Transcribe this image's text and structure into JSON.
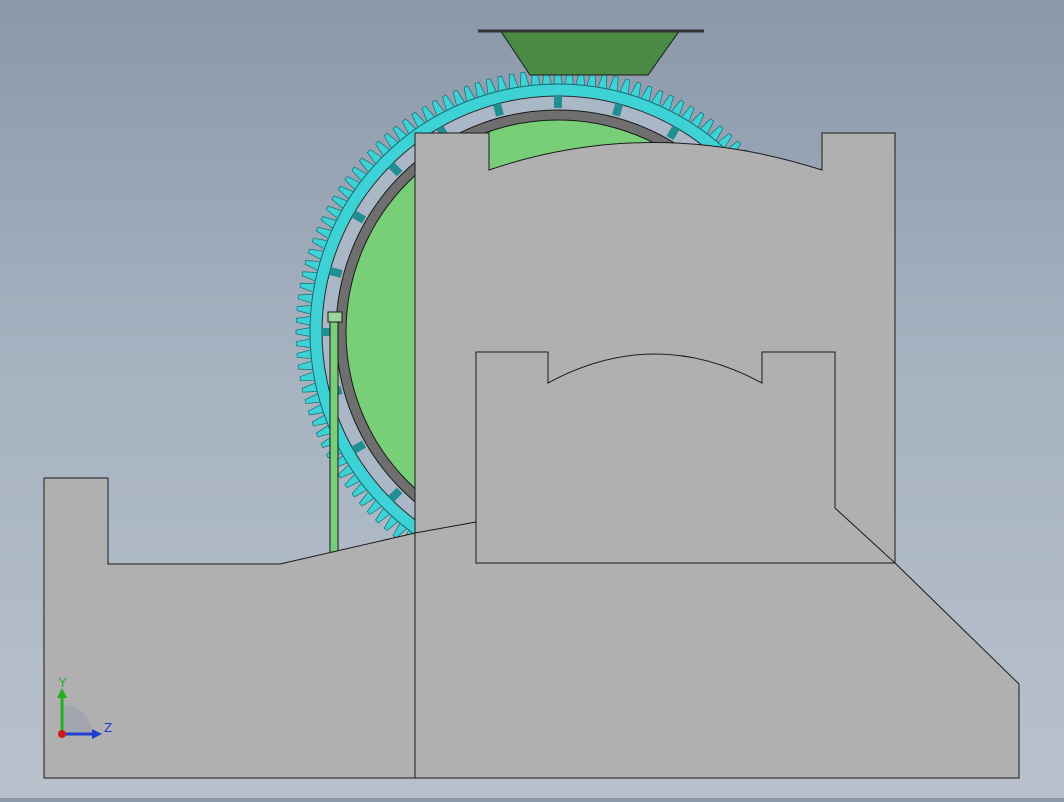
{
  "viewport": {
    "background_top": "#8a98aa",
    "background_bottom": "#b9c1cd"
  },
  "model": {
    "body_color": "#b0b0b0",
    "gear_color": "#3cd2d6",
    "drum_color": "#78cf78",
    "bracket_color": "#4a8a44",
    "ring_color": "#6f6f6f"
  },
  "triad": {
    "y_label": "Y",
    "z_label": "Z",
    "y_color": "#22b022",
    "z_color": "#1f3fd0",
    "origin_color": "#d01a1a"
  }
}
